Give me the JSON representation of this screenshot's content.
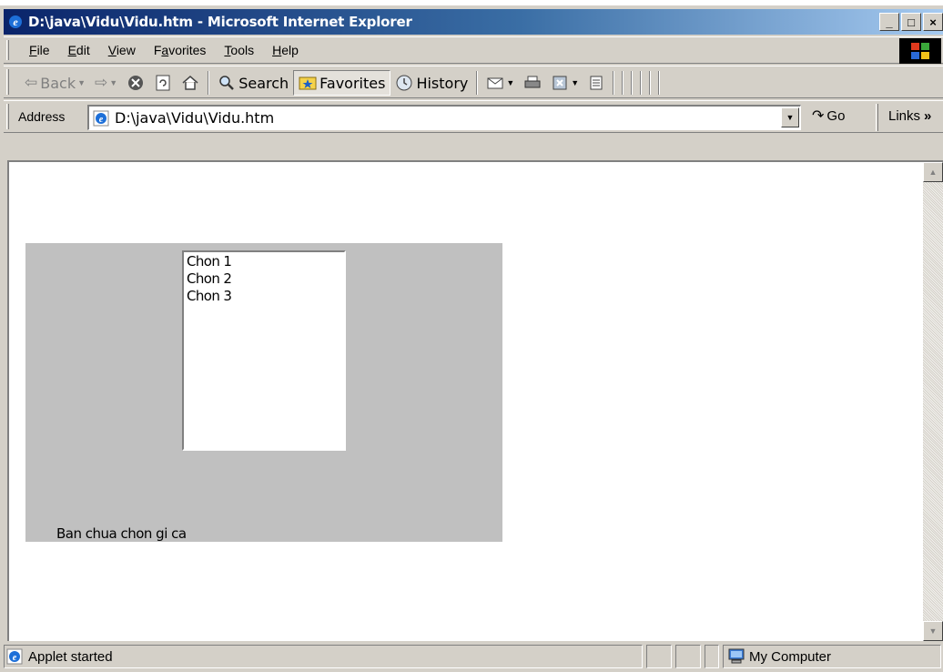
{
  "window": {
    "title": "D:\\java\\Vidu\\Vidu.htm - Microsoft Internet Explorer",
    "controls": {
      "minimize": "_",
      "maximize": "□",
      "close": "×"
    }
  },
  "menu": [
    "File",
    "Edit",
    "View",
    "Favorites",
    "Tools",
    "Help"
  ],
  "menu_hotkeys": [
    "F",
    "E",
    "V",
    "a",
    "T",
    "H"
  ],
  "toolbar": {
    "back": "Back",
    "search": "Search",
    "favorites": "Favorites",
    "history": "History"
  },
  "address": {
    "label": "Address",
    "url": "D:\\java\\Vidu\\Vidu.htm",
    "go": "Go",
    "links": "Links"
  },
  "applet": {
    "list_items": [
      "Chon 1",
      "Chon 2",
      "Chon 3"
    ],
    "status_label": "Ban chua chon gi ca"
  },
  "statusbar": {
    "text": "Applet started",
    "zone": "My Computer"
  },
  "colors": {
    "titlebar_start": "#0a246a",
    "titlebar_end": "#a6caf0",
    "chrome": "#d4d0c8",
    "applet_bg": "#c0c0c0"
  }
}
